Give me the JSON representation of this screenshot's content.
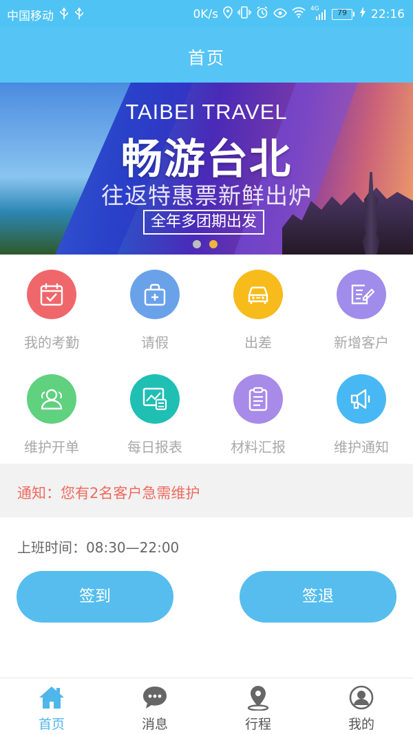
{
  "status_bar": {
    "carrier": "中国移动",
    "net_speed": "0K/s",
    "signal": "4G",
    "battery": "79",
    "time": "22:16"
  },
  "header": {
    "title": "首页"
  },
  "banner": {
    "title_en": "TAIBEI TRAVEL",
    "title_zh": "畅游台北",
    "subtitle": "往返特惠票新鲜出炉",
    "tag": "全年多团期出发",
    "slide_index": 2,
    "slide_count": 2
  },
  "grid": [
    {
      "label": "我的考勤",
      "icon": "attendance-calendar-icon",
      "color": "#f0676b"
    },
    {
      "label": "请假",
      "icon": "leave-briefcase-icon",
      "color": "#6aa2ea"
    },
    {
      "label": "出差",
      "icon": "business-trip-car-icon",
      "color": "#f8bb1c"
    },
    {
      "label": "新增客户",
      "icon": "add-customer-note-icon",
      "color": "#9f8ceb"
    },
    {
      "label": "维护开单",
      "icon": "maintain-order-users-icon",
      "color": "#5fd17f"
    },
    {
      "label": "每日报表",
      "icon": "daily-report-chart-icon",
      "color": "#1fbfb4"
    },
    {
      "label": "材料汇报",
      "icon": "material-report-clipboard-icon",
      "color": "#a88be8"
    },
    {
      "label": "维护通知",
      "icon": "maintenance-notice-megaphone-icon",
      "color": "#47b8f3"
    }
  ],
  "notice": {
    "text": "通知：您有2名客户急需维护"
  },
  "schedule": {
    "work_time_label": "上班时间：",
    "work_time_value": "08:30—22:00",
    "check_in": "签到",
    "check_out": "签退"
  },
  "bottom_nav": [
    {
      "label": "首页",
      "icon": "home-icon",
      "active": true
    },
    {
      "label": "消息",
      "icon": "message-bubble-icon",
      "active": false
    },
    {
      "label": "行程",
      "icon": "location-pin-icon",
      "active": false
    },
    {
      "label": "我的",
      "icon": "profile-user-icon",
      "active": false
    }
  ],
  "colors": {
    "primary": "#56c5f6",
    "button": "#56bdee",
    "notice_text": "#f06a5e",
    "nav_active": "#4fb6ea"
  }
}
